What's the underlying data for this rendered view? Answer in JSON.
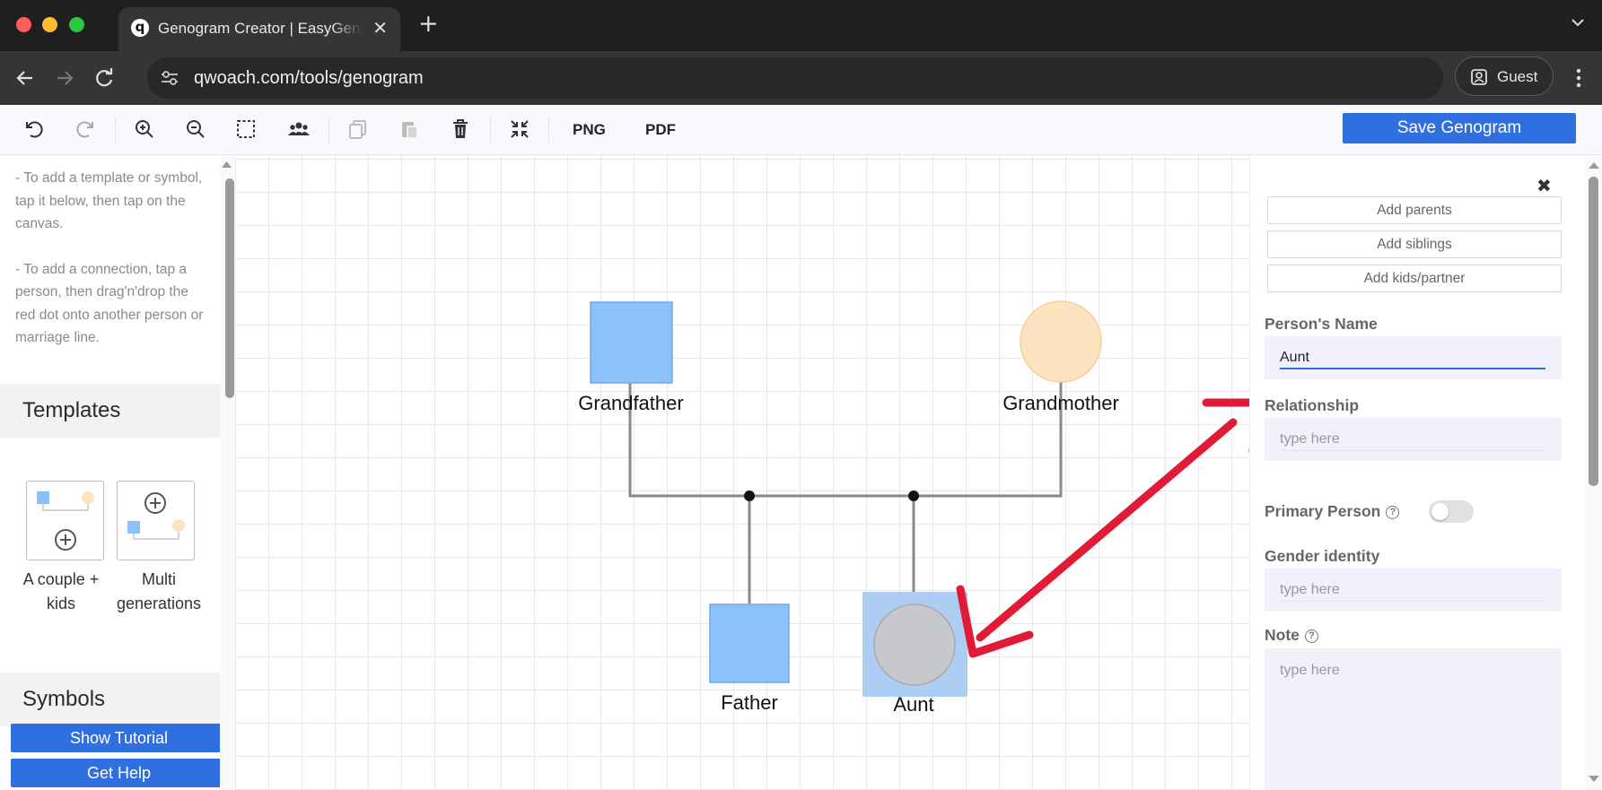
{
  "browser": {
    "tab_title": "Genogram Creator | EasyGenogram",
    "tab_favicon": "q",
    "url": "qwoach.com/tools/genogram",
    "profile_label": "Guest"
  },
  "toolbar": {
    "icons": [
      "undo-icon",
      "redo-icon",
      "zoom-in-icon",
      "zoom-out-icon",
      "select-area-icon",
      "group-icon",
      "copy-icon",
      "paste-icon",
      "delete-icon",
      "fit-screen-icon"
    ],
    "png_label": "PNG",
    "pdf_label": "PDF",
    "save_label": "Save Genogram"
  },
  "sidebar": {
    "help_1": "- To add a template or symbol, tap it below, then tap on the canvas.",
    "help_2": "- To add a connection, tap a person, then drag'n'drop the red dot onto another person or marriage line.",
    "templates_heading": "Templates",
    "templates": [
      {
        "label_line1": "A couple +",
        "label_line2": "kids"
      },
      {
        "label_line1": "Multi",
        "label_line2": "generations"
      }
    ],
    "symbols_heading": "Symbols",
    "show_tutorial_label": "Show Tutorial",
    "get_help_label": "Get Help"
  },
  "genogram": {
    "people": [
      {
        "name": "Grandfather",
        "shape": "square",
        "color": "#8cc2fa"
      },
      {
        "name": "Grandmother",
        "shape": "circle",
        "color": "#fde3bf"
      },
      {
        "name": "Father",
        "shape": "square",
        "color": "#8cc2fa"
      },
      {
        "name": "Aunt",
        "shape": "circle",
        "color": "#c7c8cc",
        "selected": true
      }
    ],
    "selection_color": "#aecdf3",
    "arrow_color": "#e11b36"
  },
  "panel": {
    "add_parents_label": "Add parents",
    "add_siblings_label": "Add siblings",
    "add_kids_label": "Add kids/partner",
    "name_label": "Person's Name",
    "name_value": "Aunt",
    "relationship_label": "Relationship",
    "relationship_placeholder": "type here",
    "primary_label": "Primary Person",
    "primary_on": false,
    "gender_label": "Gender identity",
    "gender_placeholder": "type here",
    "note_label": "Note",
    "note_placeholder": "type here"
  }
}
